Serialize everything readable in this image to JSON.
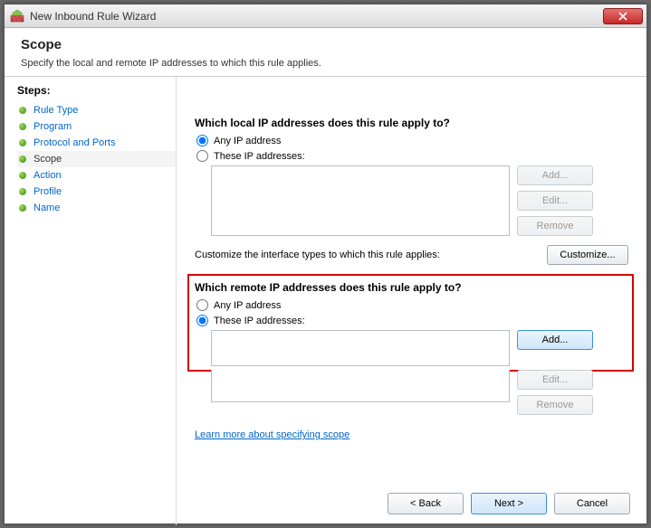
{
  "window": {
    "title": "New Inbound Rule Wizard"
  },
  "header": {
    "heading": "Scope",
    "subtext": "Specify the local and remote IP addresses to which this rule applies."
  },
  "steps": {
    "label": "Steps:",
    "items": [
      {
        "label": "Rule Type",
        "current": false
      },
      {
        "label": "Program",
        "current": false
      },
      {
        "label": "Protocol and Ports",
        "current": false
      },
      {
        "label": "Scope",
        "current": true
      },
      {
        "label": "Action",
        "current": false
      },
      {
        "label": "Profile",
        "current": false
      },
      {
        "label": "Name",
        "current": false
      }
    ]
  },
  "local": {
    "question": "Which local IP addresses does this rule apply to?",
    "option_any": "Any IP address",
    "option_these": "These IP addresses:",
    "add": "Add...",
    "edit": "Edit...",
    "remove": "Remove"
  },
  "customize": {
    "text": "Customize the interface types to which this rule applies:",
    "button": "Customize..."
  },
  "remote": {
    "question": "Which remote IP addresses does this rule apply to?",
    "option_any": "Any IP address",
    "option_these": "These IP addresses:",
    "add": "Add...",
    "edit": "Edit...",
    "remove": "Remove"
  },
  "learn_more": "Learn more about specifying scope",
  "footer": {
    "back": "< Back",
    "next": "Next >",
    "cancel": "Cancel"
  }
}
